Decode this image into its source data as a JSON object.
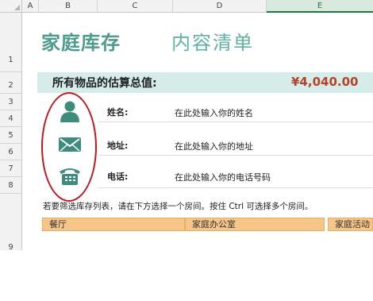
{
  "columns": {
    "a": "A",
    "b": "B",
    "c": "C",
    "d": "D",
    "e": "E"
  },
  "rows": [
    "1",
    "2",
    "3",
    "4",
    "5",
    "6",
    "7",
    "8",
    "9"
  ],
  "title": {
    "main": "家庭库存",
    "sub": "内容清单"
  },
  "summary": {
    "label": "所有物品的估算总值:",
    "value": "¥4,040.00"
  },
  "info": {
    "name_label": "姓名:",
    "name_value": "在此处输入你的姓名",
    "address_label": "地址:",
    "address_value": "在此处输入你的地址",
    "phone_label": "电话:",
    "phone_value": "在此处输入你的电话号码"
  },
  "icons": {
    "person": "person-icon",
    "mail": "envelope-icon",
    "phone": "telephone-icon"
  },
  "hint": "若要筛选库存列表，请在下方选择一个房间。按住 Ctrl 可选择多个房间。",
  "rooms": [
    "餐厅",
    "家庭办公室",
    "家庭活动"
  ],
  "colors": {
    "accent": "#4e9a8d",
    "band": "#d5ece8",
    "value": "#b5422a",
    "slicer": "#f6c689",
    "highlight_circle": "#c0161f"
  }
}
